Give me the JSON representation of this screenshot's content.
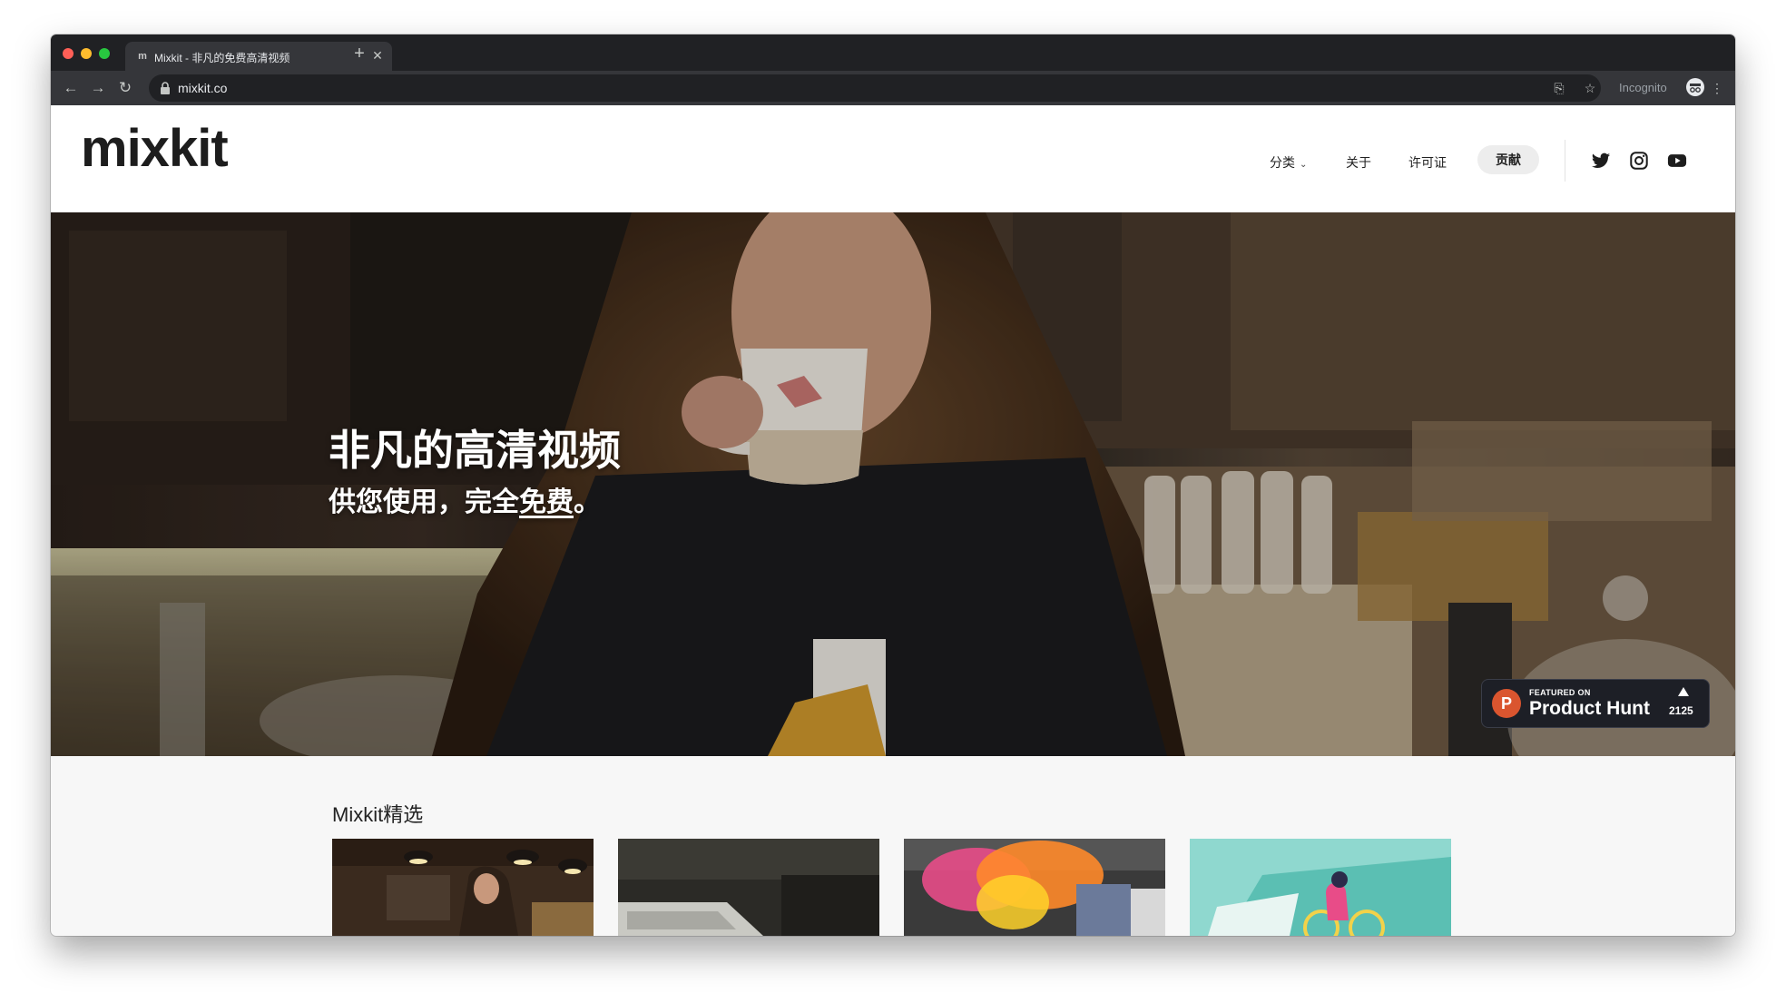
{
  "browser": {
    "tab_title": "Mixkit - 非凡的免费高清视频",
    "tab_favicon": "m",
    "url": "mixkit.co",
    "incognito_label": "Incognito",
    "icons": [
      "close-icon",
      "plus-icon",
      "back-arrow-icon",
      "forward-arrow-icon",
      "reload-icon",
      "lock-icon",
      "translate-icon",
      "star-icon",
      "incognito-icon",
      "more-vert-icon"
    ]
  },
  "site": {
    "logo": "mixkit",
    "nav": {
      "categories": "分类",
      "about": "关于",
      "license": "许可证",
      "contribute": "贡献"
    },
    "social_icons": [
      "twitter-icon",
      "instagram-icon",
      "youtube-icon"
    ]
  },
  "hero": {
    "title": "非凡的高清视频",
    "subtitle_prefix": "供您使用，完全",
    "subtitle_free": "免费",
    "subtitle_suffix": "。"
  },
  "product_hunt": {
    "small_text": "FEATURED ON",
    "name": "Product Hunt",
    "logo_letter": "P",
    "count": "2125"
  },
  "featured": {
    "title": "Mixkit精选"
  },
  "colors": {
    "chrome_dark": "#202124",
    "chrome_toolbar": "#35363a",
    "product_hunt_orange": "#da552f",
    "page_bg": "#f7f7f7"
  }
}
